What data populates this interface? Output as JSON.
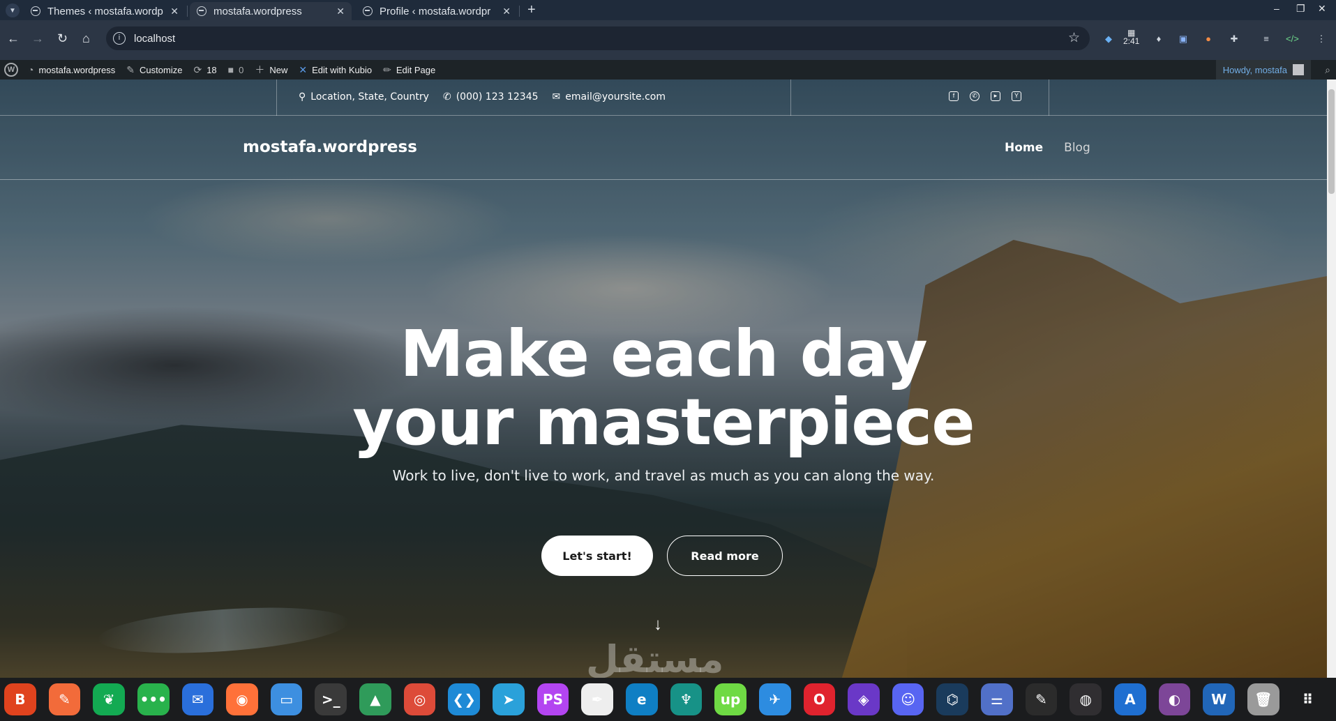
{
  "browser": {
    "tabs": [
      {
        "title": "Themes ‹ mostafa.wordp",
        "active": false
      },
      {
        "title": "mostafa.wordpress",
        "active": true
      },
      {
        "title": "Profile ‹ mostafa.wordpr",
        "active": false
      }
    ],
    "new_tab": "+",
    "url": "localhost",
    "clock": "2:41",
    "window_controls": [
      "–",
      "❐",
      "✕"
    ]
  },
  "admin_bar": {
    "site_name": "mostafa.wordpress",
    "customize": "Customize",
    "updates_count": "18",
    "comments_count": "0",
    "new": "New",
    "edit_kubio": "Edit with Kubio",
    "edit_page": "Edit Page",
    "howdy": "Howdy, mostafa"
  },
  "contact": {
    "location": "Location, State, Country",
    "phone": "(000) 123 12345",
    "email": "email@yoursite.com"
  },
  "social_icons": [
    "facebook-icon",
    "whatsapp-icon",
    "youtube-icon",
    "yelp-icon"
  ],
  "header": {
    "site_title": "mostafa.wordpress",
    "menu": [
      {
        "label": "Home",
        "active": true
      },
      {
        "label": "Blog",
        "active": false
      }
    ]
  },
  "hero": {
    "title_line1": "Make each day",
    "title_line2": "your masterpiece",
    "subtitle": "Work to live, don't live to work, and travel as much as you can along the way.",
    "primary_button": "Let's start!",
    "secondary_button": "Read more"
  },
  "watermark": "مستقل",
  "dock_apps": [
    {
      "name": "brave",
      "color": "#e0431e",
      "glyph": "B"
    },
    {
      "name": "postman",
      "color": "#f26b3a",
      "glyph": "✎"
    },
    {
      "name": "mongodb-compass",
      "color": "#13aa52",
      "glyph": "❦"
    },
    {
      "name": "chat",
      "color": "#29b24c",
      "glyph": "•••"
    },
    {
      "name": "thunderbird",
      "color": "#2a6fdb",
      "glyph": "✉"
    },
    {
      "name": "firefox",
      "color": "#ff7139",
      "glyph": "◉"
    },
    {
      "name": "files",
      "color": "#3d8fe0",
      "glyph": "▭"
    },
    {
      "name": "terminal",
      "color": "#3a3a3a",
      "glyph": ">_"
    },
    {
      "name": "system-monitor",
      "color": "#2f9b5a",
      "glyph": "▲"
    },
    {
      "name": "chrome",
      "color": "#dd4b39",
      "glyph": "◎"
    },
    {
      "name": "vscode",
      "color": "#1e8ad6",
      "glyph": "❮❯"
    },
    {
      "name": "telegram",
      "color": "#2aa1da",
      "glyph": "➤"
    },
    {
      "name": "phpstorm",
      "color": "#b345f1",
      "glyph": "PS"
    },
    {
      "name": "inkscape",
      "color": "#eeeeee",
      "glyph": "✒"
    },
    {
      "name": "edge",
      "color": "#0f7fc4",
      "glyph": "e"
    },
    {
      "name": "gitkraken",
      "color": "#179287",
      "glyph": "♆"
    },
    {
      "name": "upwork",
      "color": "#6fda44",
      "glyph": "up"
    },
    {
      "name": "mailspring",
      "color": "#2d8ce0",
      "glyph": "✈"
    },
    {
      "name": "opera",
      "color": "#e0232e",
      "glyph": "O"
    },
    {
      "name": "insomnia",
      "color": "#6a38c7",
      "glyph": "◈"
    },
    {
      "name": "discord",
      "color": "#5865f2",
      "glyph": "☺"
    },
    {
      "name": "mysql-workbench",
      "color": "#1a3b5c",
      "glyph": "⌬"
    },
    {
      "name": "toggl",
      "color": "#5170c8",
      "glyph": "⚌"
    },
    {
      "name": "text-editor",
      "color": "#2b2b2b",
      "glyph": "✎"
    },
    {
      "name": "obs-studio",
      "color": "#302e31",
      "glyph": "◍"
    },
    {
      "name": "app-store",
      "color": "#1f6fd1",
      "glyph": "A"
    },
    {
      "name": "tor-browser",
      "color": "#7d4698",
      "glyph": "◐"
    },
    {
      "name": "writer",
      "color": "#2166b8",
      "glyph": "W"
    },
    {
      "name": "trash",
      "color": "#9a9a9a",
      "glyph": "🗑"
    },
    {
      "name": "app-grid",
      "color": "#1b1c1e",
      "glyph": "⠿"
    }
  ]
}
